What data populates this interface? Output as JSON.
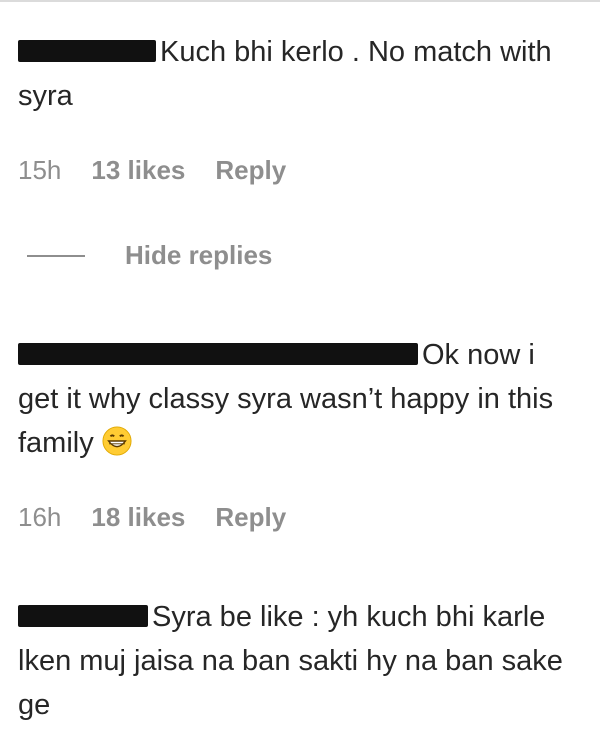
{
  "comments": [
    {
      "text": "Kuch bhi kerlo . No match with syra",
      "time": "15h",
      "likes": "13 likes",
      "reply": "Reply"
    },
    {
      "text": "Ok now i get it why classy syra wasn’t happy in this family",
      "emoji": "grinning-face-emoji",
      "time": "16h",
      "likes": "18 likes",
      "reply": "Reply"
    },
    {
      "text": "Syra be like : yh kuch bhi karle lken muj jaisa na ban sakti hy na ban sake ge"
    }
  ],
  "hide_replies": "Hide replies",
  "colors": {
    "text": "#262626",
    "meta": "#8e8e8e",
    "redaction": "#111111"
  }
}
